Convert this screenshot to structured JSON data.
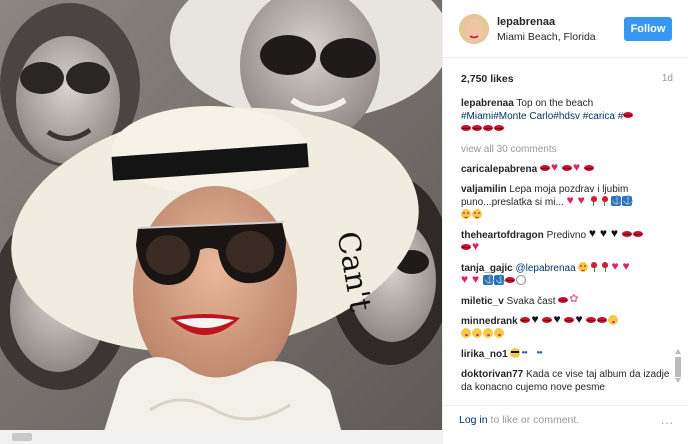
{
  "post": {
    "username": "lepabrenaa",
    "location": "Miami Beach, Florida",
    "follow_label": "Follow",
    "likes": "2,750 likes",
    "age": "1d"
  },
  "caption": {
    "author": "lepabrenaa",
    "text": "Top on the beach",
    "tags": "#Miami#Monte Carlo#hdsv #carica #"
  },
  "view_all": "view all 30 comments",
  "comments": [
    {
      "author": "caricalepabrena",
      "text": ""
    },
    {
      "author": "valjamilin",
      "text": "Lepa moja pozdrav i ljubim puno...preslatka si mi..."
    },
    {
      "author": "theheartofdragon",
      "text": "Predivno"
    },
    {
      "author": "tanja_gajic",
      "text": "@lepabrenaa"
    },
    {
      "author": "miletic_v",
      "text": "Svaka čast"
    },
    {
      "author": "minnedrank",
      "text": ""
    },
    {
      "author": "lirika_no1",
      "text": ""
    },
    {
      "author": "doktorivan77",
      "text": "Kada ce vise taj album da izadje da konacno cujemo nove pesme"
    }
  ],
  "footer": {
    "login_link": "Log in",
    "login_rest": "to like or comment.",
    "more": "..."
  },
  "icons": [
    "lips-icon",
    "heart-icon",
    "rose-icon",
    "anchor-icon",
    "smiling-face-icon",
    "black-heart-icon",
    "flower-icon",
    "sunglasses-face-icon",
    "glasses-icon",
    "more-options-icon"
  ],
  "colors": {
    "follow": "#3897f0",
    "link": "#003569",
    "muted": "#999999"
  }
}
